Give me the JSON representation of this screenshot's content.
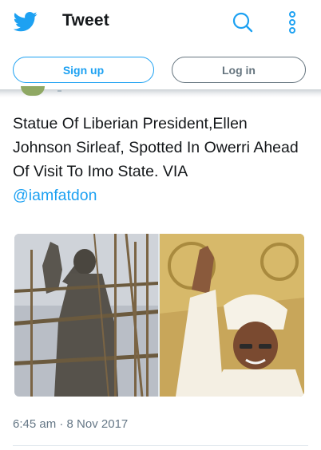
{
  "header": {
    "title": "Tweet",
    "icons": [
      "twitter-bird-icon",
      "search-icon",
      "more-options-icon"
    ]
  },
  "auth": {
    "signup_label": "Sign up",
    "login_label": "Log in"
  },
  "tweet": {
    "text": "Statue Of Liberian President,Ellen Johnson Sirleaf,  Spotted In Owerri Ahead Of Visit To Imo State.   VIA",
    "mention": "@iamfatdon",
    "timestamp": "6:45 am · 8 Nov 2017"
  },
  "colors": {
    "brand": "#1da1f2",
    "secondary": "#66757f",
    "text": "#14171a"
  }
}
